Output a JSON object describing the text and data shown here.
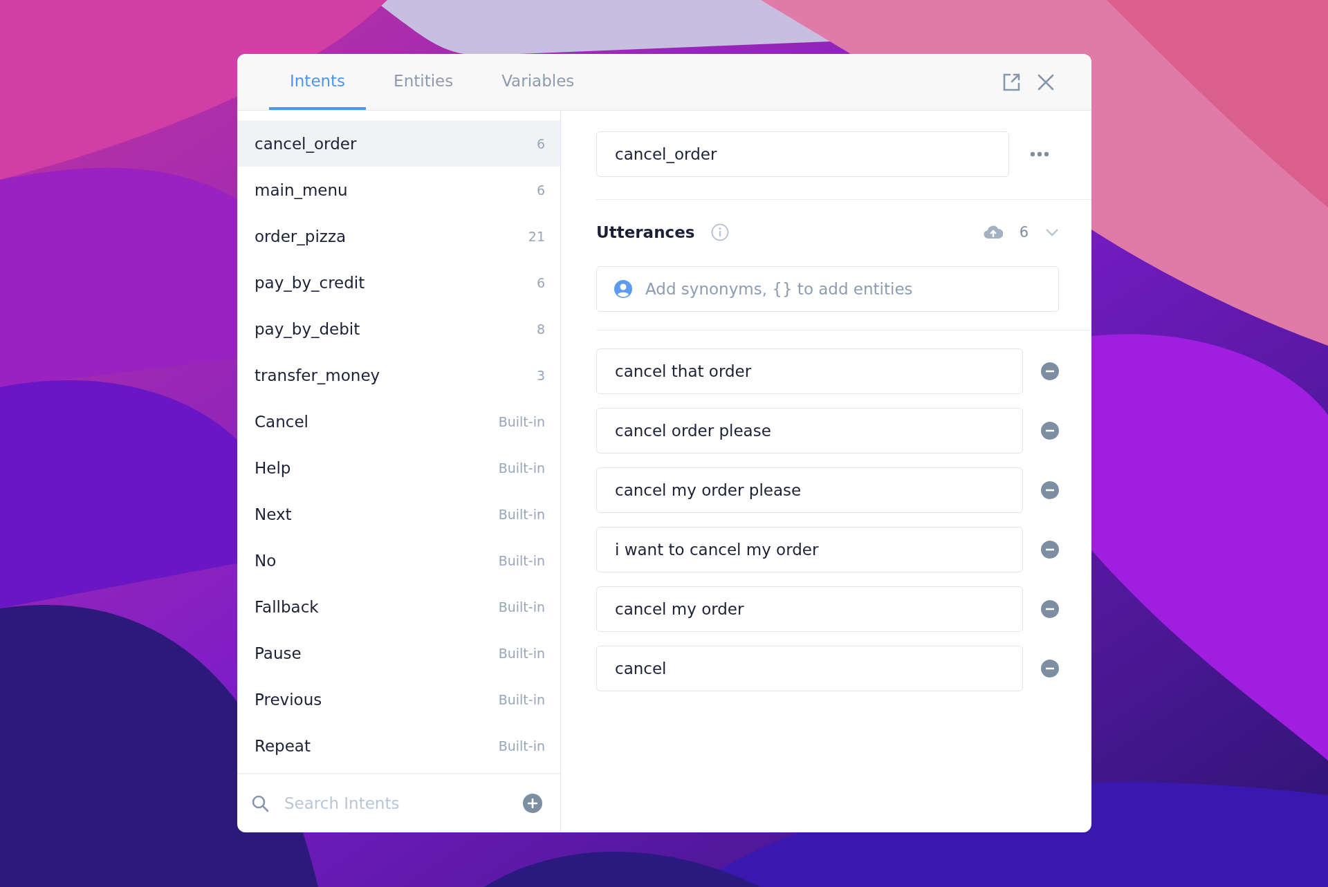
{
  "tabs": [
    {
      "label": "Intents",
      "selected": true
    },
    {
      "label": "Entities",
      "selected": false
    },
    {
      "label": "Variables",
      "selected": false
    }
  ],
  "intents": [
    {
      "name": "cancel_order",
      "count": "6",
      "selected": true
    },
    {
      "name": "main_menu",
      "count": "6",
      "selected": false
    },
    {
      "name": "order_pizza",
      "count": "21",
      "selected": false
    },
    {
      "name": "pay_by_credit",
      "count": "6",
      "selected": false
    },
    {
      "name": "pay_by_debit",
      "count": "8",
      "selected": false
    },
    {
      "name": "transfer_money",
      "count": "3",
      "selected": false
    },
    {
      "name": "Cancel",
      "count": "Built-in",
      "selected": false
    },
    {
      "name": "Help",
      "count": "Built-in",
      "selected": false
    },
    {
      "name": "Next",
      "count": "Built-in",
      "selected": false
    },
    {
      "name": "No",
      "count": "Built-in",
      "selected": false
    },
    {
      "name": "Fallback",
      "count": "Built-in",
      "selected": false
    },
    {
      "name": "Pause",
      "count": "Built-in",
      "selected": false
    },
    {
      "name": "Previous",
      "count": "Built-in",
      "selected": false
    },
    {
      "name": "Repeat",
      "count": "Built-in",
      "selected": false
    }
  ],
  "search": {
    "placeholder": "Search Intents"
  },
  "editor": {
    "name": "cancel_order",
    "heading": "Utterances",
    "count": "6",
    "input_placeholder": "Add synonyms, {} to add entities",
    "utterances": [
      "cancel that order",
      "cancel order please",
      "cancel my order please",
      "i want to cancel my order",
      "cancel my order",
      "cancel"
    ]
  }
}
